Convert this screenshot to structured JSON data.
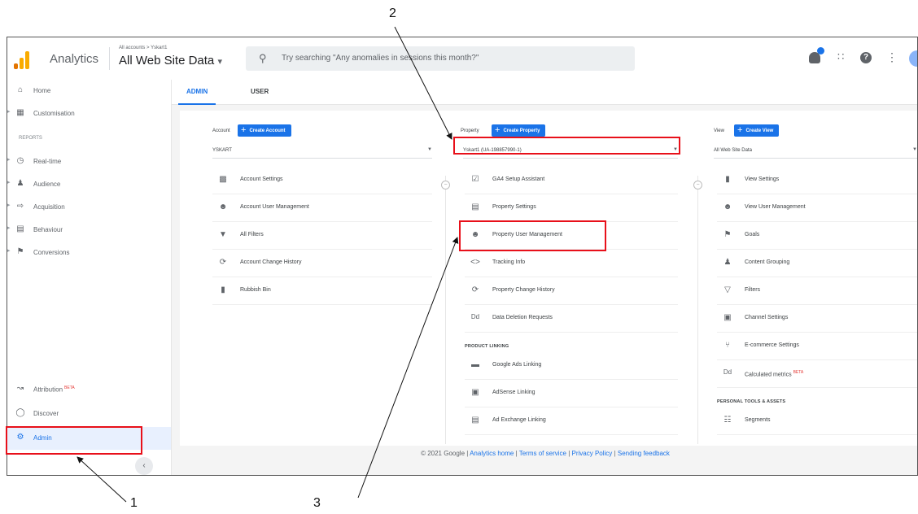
{
  "header": {
    "app_name": "Analytics",
    "breadcrumb": "All accounts > Yskart1",
    "view_name": "All Web Site Data",
    "view_caret": "▾",
    "search_placeholder": "Try searching \"Any anomalies in sessions this month?\""
  },
  "sidebar": {
    "items": [
      {
        "label": "Home",
        "icon": "home-icon"
      },
      {
        "label": "Customisation",
        "icon": "customisation-icon"
      }
    ],
    "reports_heading": "REPORTS",
    "reports": [
      {
        "label": "Real-time",
        "icon": "clock-icon"
      },
      {
        "label": "Audience",
        "icon": "person-icon"
      },
      {
        "label": "Acquisition",
        "icon": "acquisition-icon"
      },
      {
        "label": "Behaviour",
        "icon": "behaviour-icon"
      },
      {
        "label": "Conversions",
        "icon": "flag-icon"
      }
    ],
    "bottom": [
      {
        "label": "Attribution",
        "badge": "BETA",
        "icon": "attribution-icon"
      },
      {
        "label": "Discover",
        "icon": "bulb-icon"
      },
      {
        "label": "Admin",
        "icon": "gear-icon"
      }
    ],
    "collapse": "‹"
  },
  "tabs": {
    "admin": "ADMIN",
    "user": "USER"
  },
  "account": {
    "heading": "Account",
    "button": "Create Account",
    "selected": "YSKART",
    "items": [
      {
        "label": "Account Settings",
        "icon": "building-icon"
      },
      {
        "label": "Account User Management",
        "icon": "users-icon"
      },
      {
        "label": "All Filters",
        "icon": "filter-icon"
      },
      {
        "label": "Account Change History",
        "icon": "history-icon"
      },
      {
        "label": "Rubbish Bin",
        "icon": "trash-icon"
      }
    ]
  },
  "property": {
    "heading": "Property",
    "button": "Create Property",
    "selected": "Yskart1 (UA-198857990-1)",
    "items": [
      {
        "label": "GA4 Setup Assistant",
        "icon": "checkbox-icon"
      },
      {
        "label": "Property Settings",
        "icon": "property-settings-icon"
      },
      {
        "label": "Property User Management",
        "icon": "users-icon"
      },
      {
        "label": "Tracking Info",
        "icon": "code-icon"
      },
      {
        "label": "Property Change History",
        "icon": "history-icon"
      },
      {
        "label": "Data Deletion Requests",
        "icon": "dd-icon"
      }
    ],
    "linking_heading": "PRODUCT LINKING",
    "linking": [
      {
        "label": "Google Ads Linking",
        "icon": "ads-icon"
      },
      {
        "label": "AdSense Linking",
        "icon": "adsense-icon"
      },
      {
        "label": "Ad Exchange Linking",
        "icon": "adexchange-icon"
      }
    ]
  },
  "view": {
    "heading": "View",
    "button": "Create View",
    "selected": "All Web Site Data",
    "items": [
      {
        "label": "View Settings",
        "icon": "document-icon"
      },
      {
        "label": "View User Management",
        "icon": "users-icon"
      },
      {
        "label": "Goals",
        "icon": "flag-icon"
      },
      {
        "label": "Content Grouping",
        "icon": "person-icon"
      },
      {
        "label": "Filters",
        "icon": "filter-icon"
      },
      {
        "label": "Channel Settings",
        "icon": "channel-icon"
      },
      {
        "label": "E-commerce Settings",
        "icon": "cart-icon"
      },
      {
        "label": "Calculated metrics",
        "badge": "BETA",
        "icon": "dd-icon"
      }
    ],
    "tools_heading": "PERSONAL TOOLS & ASSETS",
    "tools": [
      {
        "label": "Segments",
        "icon": "segments-icon"
      }
    ]
  },
  "footer": {
    "copyright": "© 2021 Google |",
    "links": [
      "Analytics home",
      "Terms of service",
      "Privacy Policy",
      "Sending feedback"
    ],
    "sep": "|"
  },
  "callouts": [
    "1",
    "2",
    "3"
  ],
  "colors": {
    "accent": "#1a73e8",
    "highlight": "#e8101a",
    "beta": "#e53935"
  }
}
